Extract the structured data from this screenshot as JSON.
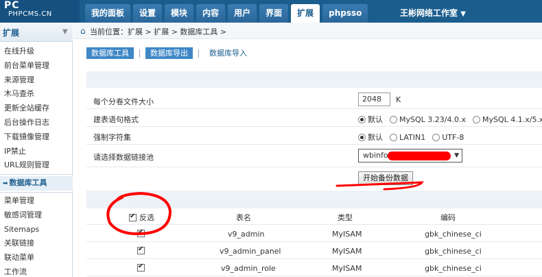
{
  "logo": {
    "text": "PC",
    "domain": "PHPCMS.CN"
  },
  "topnav": {
    "tabs": [
      "我的面板",
      "设置",
      "模块",
      "内容",
      "用户",
      "界面",
      "扩展",
      "phpsso"
    ],
    "active": 6,
    "site": "王彬网络工作室",
    "site_arrow": "▼"
  },
  "sidebar": {
    "title": "扩展",
    "items": [
      "在线升级",
      "前台菜单管理",
      "来源管理",
      "木马查杀",
      "更新全站缓存",
      "后台操作日志",
      "下载镜像管理",
      "IP禁止",
      "URL规则管理",
      "数据库工具",
      "菜单管理",
      "敏感词管理",
      "Sitemaps",
      "关联链接",
      "联动菜单",
      "工作流"
    ],
    "active": "数据库工具"
  },
  "breadcrumb": {
    "text": "当前位置：扩展 > 扩展 > 数据库工具 >"
  },
  "subtabs": [
    {
      "label": "数据库工具",
      "active": true
    },
    {
      "label": "数据库导出",
      "active": true
    },
    {
      "label": "数据库导入",
      "active": false
    }
  ],
  "form": {
    "filesize": {
      "label": "每个分卷文件大小",
      "value": "2048",
      "unit": "K"
    },
    "sqlformat": {
      "label": "建表语句格式",
      "options": [
        "默认",
        "MySQL 3.23/4.0.x",
        "MySQL 4.1.x/5.x"
      ],
      "selected": 0
    },
    "charset": {
      "label": "强制字符集",
      "options": [
        "默认",
        "LATIN1",
        "UTF-8"
      ],
      "selected": 0
    },
    "pool": {
      "label": "请选择数据链接池",
      "value": "wbinfo["
    },
    "submit_label": "开始备份数据"
  },
  "table": {
    "invert_label": "反选",
    "headers": [
      "表名",
      "类型",
      "编码"
    ],
    "rows": [
      {
        "name": "v9_admin",
        "type": "MyISAM",
        "charset": "gbk_chinese_ci",
        "checked": true
      },
      {
        "name": "v9_admin_panel",
        "type": "MyISAM",
        "charset": "gbk_chinese_ci",
        "checked": true
      },
      {
        "name": "v9_admin_role",
        "type": "MyISAM",
        "charset": "gbk_chinese_ci",
        "checked": true
      }
    ]
  },
  "colors": {
    "header": "#1b5e8e",
    "tab_active": "#3f87c6",
    "annotation": "#ff0000"
  }
}
